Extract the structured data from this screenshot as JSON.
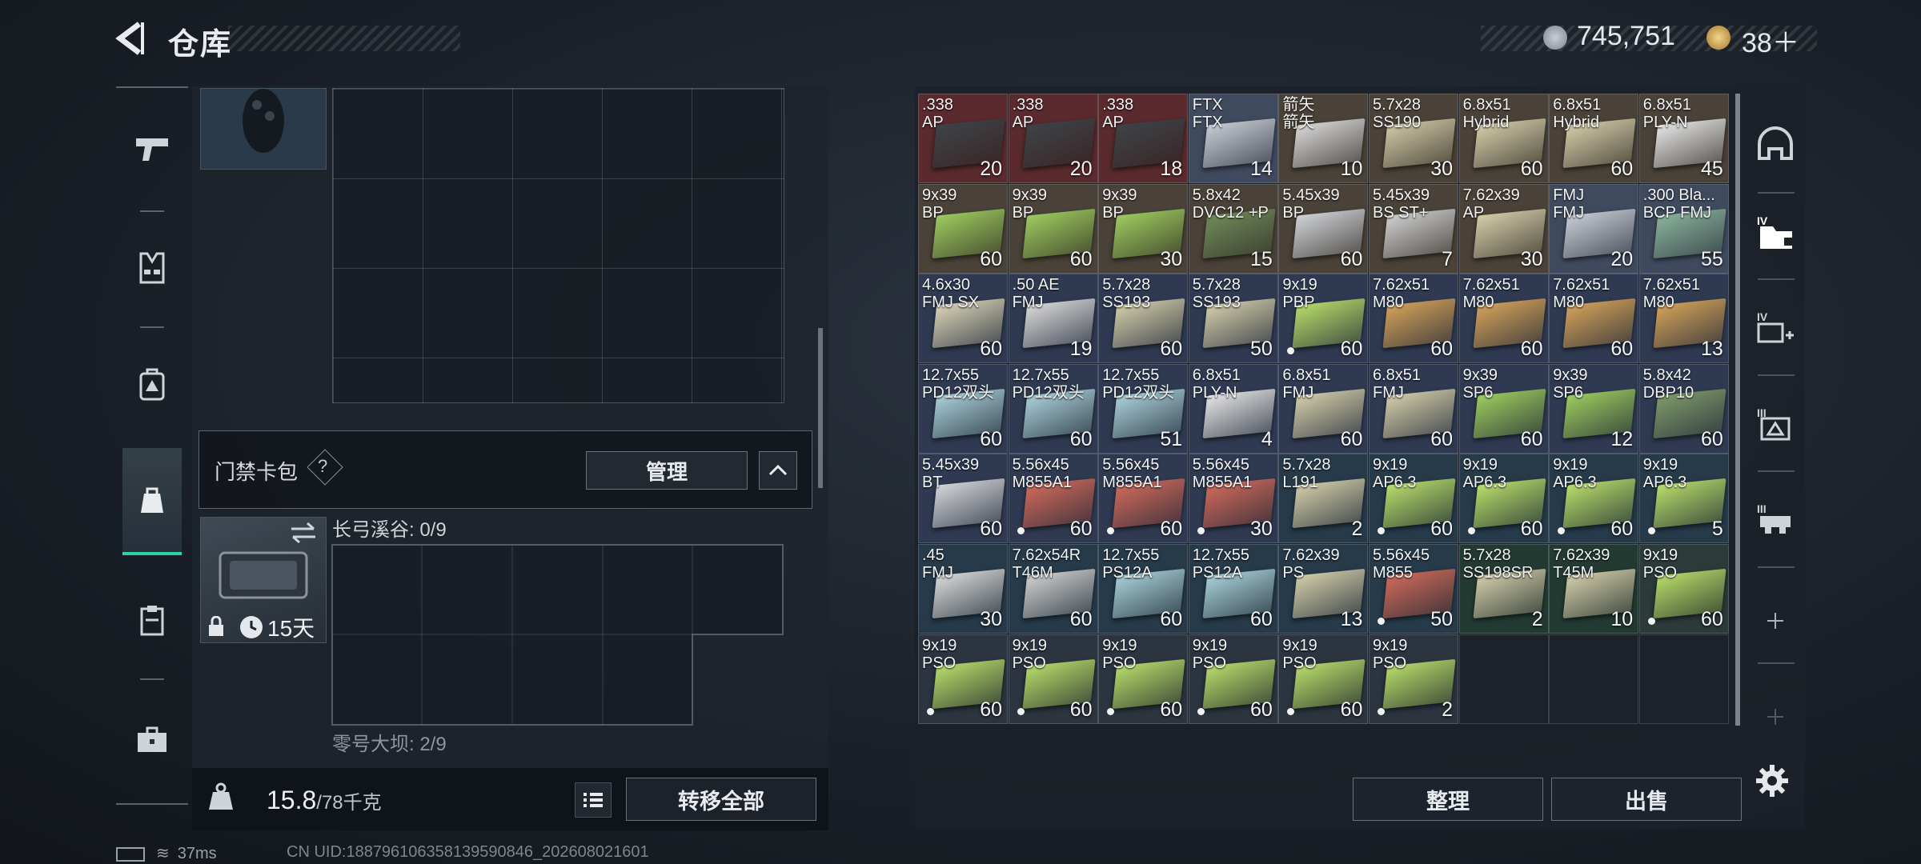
{
  "header": {
    "title": "仓库",
    "currency": {
      "coins": "745,751",
      "bonds": "38＋"
    }
  },
  "sidebar": {
    "items": [
      {
        "name": "weapons",
        "icon": "pistol-icon"
      },
      {
        "name": "armor",
        "icon": "vest-icon"
      },
      {
        "name": "backpack",
        "icon": "backpack-icon"
      },
      {
        "name": "container",
        "icon": "pouch-icon",
        "active": true
      },
      {
        "name": "clipboard",
        "icon": "clipboard-icon"
      },
      {
        "name": "case",
        "icon": "case-icon"
      }
    ]
  },
  "left_panel": {
    "keycard_label": "门禁卡包",
    "help": "?",
    "manage_label": "管理",
    "keycard_days": "15天",
    "capacity_1": "长弓溪谷: 0/9",
    "capacity_2": "零号大坝: 2/9"
  },
  "weight": {
    "current": "15.8",
    "max": "/78千克"
  },
  "transfer_label": "转移全部",
  "sort_label": "整理",
  "sell_label": "出售",
  "status": {
    "ping": "37ms",
    "uid": "CN UID:1887961063581395908​46_202608021601"
  },
  "colors": {
    "accent": "#2bd3a0",
    "panel": "#1c2129"
  },
  "inventory": [
    {
      "name": ".338\nAP",
      "qty": "20",
      "bg": "#5a2a2e",
      "box": "#3c4447",
      "dot": false
    },
    {
      "name": ".338\nAP",
      "qty": "20",
      "bg": "#5a2a2e",
      "box": "#3c4447",
      "dot": false
    },
    {
      "name": ".338\nAP",
      "qty": "18",
      "bg": "#5a2a2e",
      "box": "#3c4447",
      "dot": false
    },
    {
      "name": "FTX\nFTX",
      "qty": "14",
      "bg": "#3f4a5e",
      "box": "#c8ccd4",
      "dot": false
    },
    {
      "name": "箭矢\n箭矢",
      "qty": "10",
      "bg": "#4a4238",
      "box": "#d8d8d8",
      "dot": false
    },
    {
      "name": "5.7x28\nSS190",
      "qty": "30",
      "bg": "#4a4238",
      "box": "#cfc9a6",
      "dot": false
    },
    {
      "name": "6.8x51\nHybrid",
      "qty": "60",
      "bg": "#4a4238",
      "box": "#d3cdaa",
      "dot": false
    },
    {
      "name": "6.8x51\nHybrid",
      "qty": "60",
      "bg": "#4a4238",
      "box": "#d3cdaa",
      "dot": false
    },
    {
      "name": "6.8x51\nPLY-N",
      "qty": "45",
      "bg": "#4a4238",
      "box": "#e5e5e5",
      "dot": false
    },
    {
      "name": "9x39\nBP",
      "qty": "60",
      "bg": "#4a4238",
      "box": "#9ccb5e",
      "dot": false
    },
    {
      "name": "9x39\nBP",
      "qty": "60",
      "bg": "#4a4238",
      "box": "#9ccb5e",
      "dot": false
    },
    {
      "name": "9x39\nBP",
      "qty": "30",
      "bg": "#4a4238",
      "box": "#9ccb5e",
      "dot": false
    },
    {
      "name": "5.8x42\nDVC12 +P",
      "qty": "15",
      "bg": "#4a4238",
      "box": "#6f8a5a",
      "dot": false
    },
    {
      "name": "5.45x39\nBP",
      "qty": "60",
      "bg": "#4a4238",
      "box": "#cfd2d6",
      "dot": false
    },
    {
      "name": "5.45x39\nBS ST+",
      "qty": "7",
      "bg": "#4a4238",
      "box": "#cfcfcf",
      "dot": false
    },
    {
      "name": "7.62x39\nAP",
      "qty": "30",
      "bg": "#4a4238",
      "box": "#d3cdaa",
      "dot": false
    },
    {
      "name": "FMJ\nFMJ",
      "qty": "20",
      "bg": "#3f4a5e",
      "box": "#c8ccd4",
      "dot": false
    },
    {
      "name": ".300 Bla...\nBCP FMJ",
      "qty": "55",
      "bg": "#3f4a5e",
      "box": "#8ab39a",
      "dot": false
    },
    {
      "name": "4.6x30\nFMJ SX",
      "qty": "60",
      "bg": "#2f3a52",
      "box": "#d9d3b6",
      "dot": false
    },
    {
      "name": ".50 AE\nFMJ",
      "qty": "19",
      "bg": "#2f3a52",
      "box": "#d9d9d9",
      "dot": false
    },
    {
      "name": "5.7x28\nSS193",
      "qty": "60",
      "bg": "#2f3a52",
      "box": "#d3cdaa",
      "dot": false
    },
    {
      "name": "5.7x28\nSS193",
      "qty": "50",
      "bg": "#2f3a52",
      "box": "#d3cdaa",
      "dot": false
    },
    {
      "name": "9x19\nPBP",
      "qty": "60",
      "bg": "#2f3a52",
      "box": "#b7dc6a",
      "dot": true
    },
    {
      "name": "7.62x51\nM80",
      "qty": "60",
      "bg": "#2f3a52",
      "box": "#d3a25a",
      "dot": false
    },
    {
      "name": "7.62x51\nM80",
      "qty": "60",
      "bg": "#2f3a52",
      "box": "#d3a25a",
      "dot": false
    },
    {
      "name": "7.62x51\nM80",
      "qty": "60",
      "bg": "#2f3a52",
      "box": "#d3a25a",
      "dot": false
    },
    {
      "name": "7.62x51\nM80",
      "qty": "13",
      "bg": "#2f3a52",
      "box": "#d3a25a",
      "dot": false
    },
    {
      "name": "12.7x55\nPD12双头",
      "qty": "60",
      "bg": "#2f3a52",
      "box": "#a9d0d9",
      "dot": false
    },
    {
      "name": "12.7x55\nPD12双头",
      "qty": "60",
      "bg": "#2f3a52",
      "box": "#a9d0d9",
      "dot": false
    },
    {
      "name": "12.7x55\nPD12双头",
      "qty": "51",
      "bg": "#2f3a52",
      "box": "#a9d0d9",
      "dot": false
    },
    {
      "name": "6.8x51\nPLY-N",
      "qty": "4",
      "bg": "#2f3a52",
      "box": "#e5e5e5",
      "dot": false
    },
    {
      "name": "6.8x51\nFMJ",
      "qty": "60",
      "bg": "#2f3a52",
      "box": "#d3cdaa",
      "dot": false
    },
    {
      "name": "6.8x51\nFMJ",
      "qty": "60",
      "bg": "#2f3a52",
      "box": "#d3cdaa",
      "dot": false
    },
    {
      "name": "9x39\nSP6",
      "qty": "60",
      "bg": "#2f3a52",
      "box": "#9ccb5e",
      "dot": false
    },
    {
      "name": "9x39\nSP6",
      "qty": "12",
      "bg": "#2f3a52",
      "box": "#9ccb5e",
      "dot": false
    },
    {
      "name": "5.8x42\nDBP10",
      "qty": "60",
      "bg": "#2f3a52",
      "box": "#7f9b6a",
      "dot": false
    },
    {
      "name": "5.45x39\nBT",
      "qty": "60",
      "bg": "#2f3a52",
      "box": "#d3d5d8",
      "dot": false
    },
    {
      "name": "5.56x45\nM855A1",
      "qty": "60",
      "bg": "#2f3a52",
      "box": "#d06a5a",
      "dot": true
    },
    {
      "name": "5.56x45\nM855A1",
      "qty": "60",
      "bg": "#2f3a52",
      "box": "#d06a5a",
      "dot": true
    },
    {
      "name": "5.56x45\nM855A1",
      "qty": "30",
      "bg": "#2f3a52",
      "box": "#d06a5a",
      "dot": true
    },
    {
      "name": "5.7x28\nL191",
      "qty": "2",
      "bg": "#263a4a",
      "box": "#d3cdaa",
      "dot": false
    },
    {
      "name": "9x19\nAP6.3",
      "qty": "60",
      "bg": "#263a4a",
      "box": "#b7dc6a",
      "dot": true
    },
    {
      "name": "9x19\nAP6.3",
      "qty": "60",
      "bg": "#263a4a",
      "box": "#b7dc6a",
      "dot": true
    },
    {
      "name": "9x19\nAP6.3",
      "qty": "60",
      "bg": "#263a4a",
      "box": "#b7dc6a",
      "dot": true
    },
    {
      "name": "9x19\nAP6.3",
      "qty": "5",
      "bg": "#263a4a",
      "box": "#b7dc6a",
      "dot": true
    },
    {
      "name": ".45\nFMJ",
      "qty": "30",
      "bg": "#263a4a",
      "box": "#d9d9d9",
      "dot": false
    },
    {
      "name": "7.62x54R\nT46M",
      "qty": "60",
      "bg": "#263a4a",
      "box": "#cfcfcf",
      "dot": false
    },
    {
      "name": "12.7x55\nPS12A",
      "qty": "60",
      "bg": "#263a4a",
      "box": "#a9d0d9",
      "dot": false
    },
    {
      "name": "12.7x55\nPS12A",
      "qty": "60",
      "bg": "#263a4a",
      "box": "#a9d0d9",
      "dot": false
    },
    {
      "name": "7.62x39\nPS",
      "qty": "13",
      "bg": "#263a4a",
      "box": "#d3cdaa",
      "dot": false
    },
    {
      "name": "5.56x45\nM855",
      "qty": "50",
      "bg": "#263a4a",
      "box": "#d06a5a",
      "dot": true
    },
    {
      "name": "5.7x28\nSS198SR",
      "qty": "2",
      "bg": "#233a33",
      "box": "#d3cdaa",
      "dot": false
    },
    {
      "name": "7.62x39\nT45M",
      "qty": "10",
      "bg": "#233a33",
      "box": "#d3cdaa",
      "dot": false
    },
    {
      "name": "9x19\nPSO",
      "qty": "60",
      "bg": "#2c3a3a",
      "box": "#b7dc6a",
      "dot": true
    },
    {
      "name": "9x19\nPSO",
      "qty": "60",
      "bg": "#2c3440",
      "box": "#b7dc6a",
      "dot": true
    },
    {
      "name": "9x19\nPSO",
      "qty": "60",
      "bg": "#2c3440",
      "box": "#b7dc6a",
      "dot": true
    },
    {
      "name": "9x19\nPSO",
      "qty": "60",
      "bg": "#2c3440",
      "box": "#b7dc6a",
      "dot": true
    },
    {
      "name": "9x19\nPSO",
      "qty": "60",
      "bg": "#2c3440",
      "box": "#b7dc6a",
      "dot": true
    },
    {
      "name": "9x19\nPSO",
      "qty": "60",
      "bg": "#2c3440",
      "box": "#b7dc6a",
      "dot": true
    },
    {
      "name": "9x19\nPSO",
      "qty": "2",
      "bg": "#2c3440",
      "box": "#b7dc6a",
      "dot": true
    }
  ],
  "right_sidebar": [
    {
      "icon": "helmet-icon"
    },
    {
      "icon": "armor-folder-icon"
    },
    {
      "icon": "armor-plus-icon"
    },
    {
      "icon": "armor-level-icon"
    },
    {
      "icon": "rig-level-icon"
    },
    {
      "icon": "plus-icon"
    },
    {
      "icon": "plus-icon-dim"
    }
  ]
}
